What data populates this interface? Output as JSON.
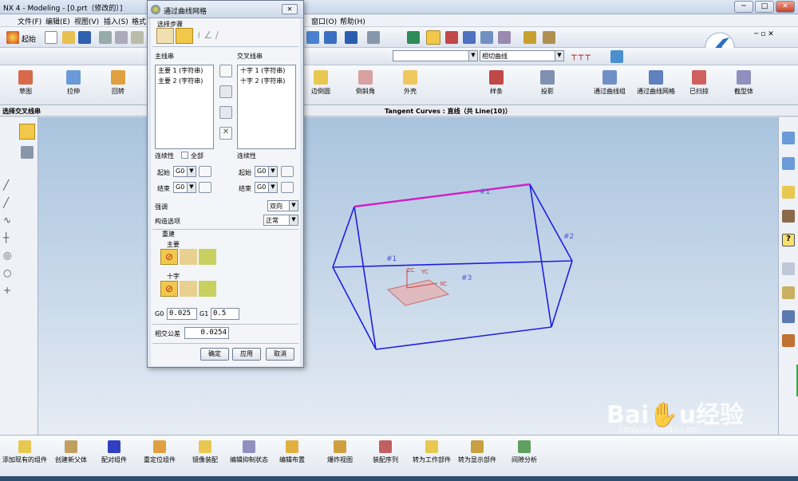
{
  "app": {
    "title": "NX 4 - Modeling - [0.prt（修改的）]"
  },
  "menu": [
    "文件(F)",
    "编辑(E)",
    "视图(V)",
    "插入(S)",
    "格式",
    "窗口(O)",
    "帮助(H)"
  ],
  "toolbar": {
    "start_label": "起始",
    "curve_rule": "相切曲线",
    "filter_value": ""
  },
  "feature_toolbar": [
    "草图",
    "拉伸",
    "回转",
    "边倒圆",
    "倒斜角",
    "外壳",
    "样条",
    "投影",
    "通过曲线组",
    "通过曲线网格",
    "已扫掠",
    "截型体"
  ],
  "status": {
    "prompt": "选择交叉线串",
    "info": "Tangent Curves : 直线（共 Line(10)）"
  },
  "dialog": {
    "title": "通过曲线网格",
    "steps_label": "选择步骤",
    "primary_label": "主线串",
    "cross_label": "交叉线串",
    "primary_items": [
      "主要 1 (字符串)",
      "主要 2 (字符串)"
    ],
    "cross_items": [
      "十字 1 (字符串)",
      "十字 2 (字符串)"
    ],
    "continuity_label": "连续性",
    "all_label": "全部",
    "start_label": "起始",
    "end_label": "结束",
    "g0": "G0",
    "emphasis_label": "强调",
    "emphasis_value": "双向",
    "construct_label": "构造选项",
    "construct_value": "正常",
    "rebuild_label": "重建",
    "main_label": "主要",
    "cross_sub_label": "十字",
    "g0_label": "G0",
    "g0_value": "0.025",
    "g1_label": "G1",
    "g1_value": "0.5",
    "tolerance_label": "相交公差",
    "tolerance_value": "0.0254",
    "ok": "确定",
    "apply": "应用",
    "cancel": "取消"
  },
  "model_labels": {
    "c1": "#1",
    "c2": "#2",
    "c3": "#3",
    "c4": "#1",
    "xc": "XC",
    "yc": "YC",
    "zc": "ZC"
  },
  "assembly_toolbar": [
    "添加现有的组件",
    "创建新父体",
    "配对组件",
    "重定位组件",
    "镜像装配",
    "编辑抑制状态",
    "编辑布置",
    "爆炸视图",
    "装配序列",
    "转为工作部件",
    "转为显示部件",
    "间隙分析"
  ],
  "watermark": {
    "main": "Bai✋u经验",
    "sub": "jingyan.baidu.com"
  },
  "colors": {
    "accent": "#2a5db0",
    "curve": "#1f1fe0",
    "selected": "#d020c8",
    "viewport_top": "#aac4de"
  }
}
